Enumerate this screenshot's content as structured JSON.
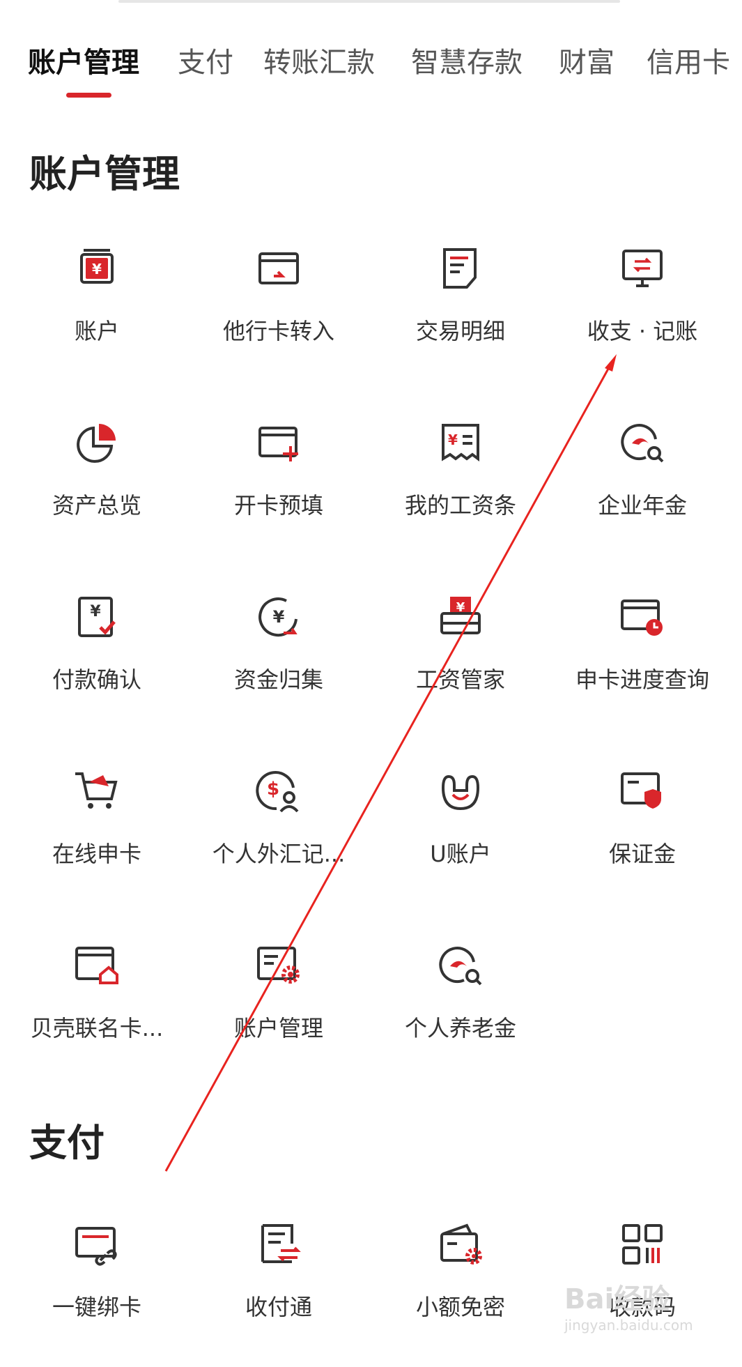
{
  "tabs": [
    {
      "label": "账户管理",
      "active": true
    },
    {
      "label": "支付",
      "active": false
    },
    {
      "label": "转账汇款",
      "active": false
    },
    {
      "label": "智慧存款",
      "active": false
    },
    {
      "label": "财富",
      "active": false
    },
    {
      "label": "信用卡",
      "active": false
    }
  ],
  "sections": {
    "account": {
      "title": "账户管理",
      "items": [
        {
          "label": "账户",
          "icon": "yen-card-icon"
        },
        {
          "label": "他行卡转入",
          "icon": "card-transfer-icon"
        },
        {
          "label": "交易明细",
          "icon": "document-list-icon"
        },
        {
          "label": "收支 · 记账",
          "icon": "monitor-exchange-icon"
        },
        {
          "label": "资产总览",
          "icon": "pie-chart-icon"
        },
        {
          "label": "开卡预填",
          "icon": "card-add-icon"
        },
        {
          "label": "我的工资条",
          "icon": "payslip-icon"
        },
        {
          "label": "企业年金",
          "icon": "pension-search-icon"
        },
        {
          "label": "付款确认",
          "icon": "payment-check-icon"
        },
        {
          "label": "资金归集",
          "icon": "fund-collect-icon"
        },
        {
          "label": "工资管家",
          "icon": "salary-printer-icon"
        },
        {
          "label": "申卡进度查询",
          "icon": "card-clock-icon"
        },
        {
          "label": "在线申卡",
          "icon": "shopping-cart-icon"
        },
        {
          "label": "个人外汇记...",
          "icon": "dollar-user-icon"
        },
        {
          "label": "U账户",
          "icon": "u-account-icon"
        },
        {
          "label": "保证金",
          "icon": "card-shield-icon"
        },
        {
          "label": "贝壳联名卡...",
          "icon": "card-home-icon"
        },
        {
          "label": "账户管理",
          "icon": "card-gear-icon"
        },
        {
          "label": "个人养老金",
          "icon": "pension-search-icon"
        }
      ]
    },
    "payment": {
      "title": "支付",
      "items": [
        {
          "label": "一键绑卡",
          "icon": "card-link-icon"
        },
        {
          "label": "收付通",
          "icon": "document-exchange-icon"
        },
        {
          "label": "小额免密",
          "icon": "wallet-gear-icon"
        },
        {
          "label": "收款码",
          "icon": "qr-code-icon"
        }
      ]
    }
  },
  "watermark": {
    "main": "Bai经验",
    "sub": "jingyan.baidu.com"
  },
  "colors": {
    "accent": "#d9262b",
    "icon_dark": "#333333",
    "text": "#333333"
  }
}
